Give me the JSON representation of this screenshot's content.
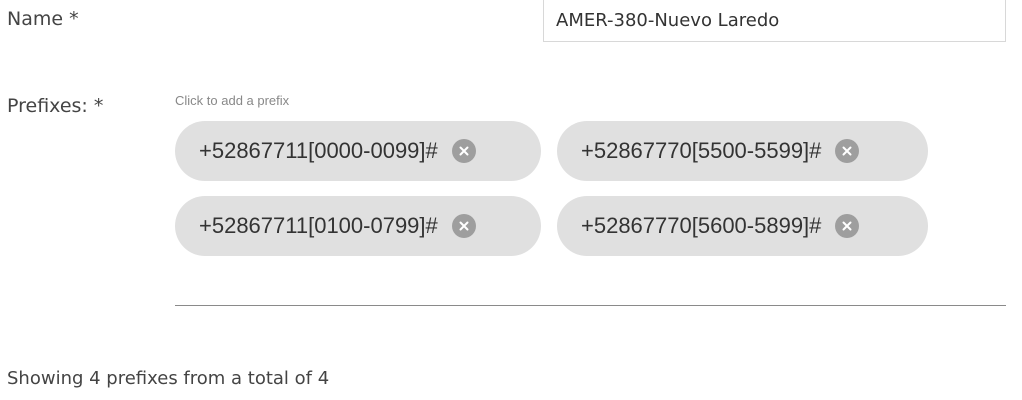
{
  "form": {
    "name_label": "Name *",
    "name_value": "AMER-380-Nuevo Laredo",
    "prefixes_label": "Prefixes: *",
    "prefix_hint": "Click to add a prefix"
  },
  "prefixes": [
    {
      "value": "+52867711[0000-0099]#",
      "remove_icon": "close-circle-icon"
    },
    {
      "value": "+52867770[5500-5599]#",
      "remove_icon": "close-circle-icon"
    },
    {
      "value": "+52867711[0100-0799]#",
      "remove_icon": "close-circle-icon"
    },
    {
      "value": "+52867770[5600-5899]#",
      "remove_icon": "close-circle-icon"
    }
  ],
  "summary": {
    "text": "Showing 4 prefixes from a total of 4"
  },
  "colors": {
    "chip_background": "#e0e0e0",
    "chip_remove_icon": "#9e9e9e",
    "divider": "#8a8a8a"
  }
}
